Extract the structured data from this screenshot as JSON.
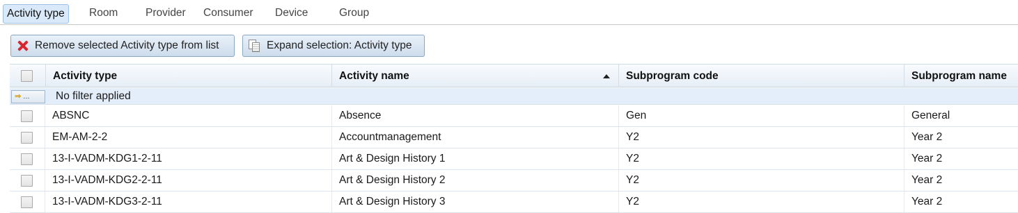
{
  "tabs": [
    {
      "label": "Activity type",
      "active": true
    },
    {
      "label": "Room"
    },
    {
      "label": "Provider"
    },
    {
      "label": "Consumer"
    },
    {
      "label": "Device"
    },
    {
      "label": "Group"
    }
  ],
  "toolbar": {
    "remove_label": "Remove selected Activity type from list",
    "remove_icon": "close-x-icon",
    "expand_label": "Expand selection: Activity type",
    "expand_icon": "documents-icon"
  },
  "grid": {
    "columns": [
      "Activity type",
      "Activity name",
      "Subprogram code",
      "Subprogram name"
    ],
    "sorted_column": "Activity name",
    "sort_direction": "ascending",
    "filter_button_label": "...",
    "filter_text": "No filter applied",
    "rows": [
      {
        "activity_type": "ABSNC",
        "activity_name": "Absence",
        "subprogram_code": "Gen",
        "subprogram_name": "General"
      },
      {
        "activity_type": "EM-AM-2-2",
        "activity_name": "Accountmanagement",
        "subprogram_code": "Y2",
        "subprogram_name": "Year 2"
      },
      {
        "activity_type": "13-I-VADM-KDG1-2-11",
        "activity_name": "Art & Design History 1",
        "subprogram_code": "Y2",
        "subprogram_name": "Year 2"
      },
      {
        "activity_type": "13-I-VADM-KDG2-2-11",
        "activity_name": "Art & Design History 2",
        "subprogram_code": "Y2",
        "subprogram_name": "Year 2"
      },
      {
        "activity_type": "13-I-VADM-KDG3-2-11",
        "activity_name": "Art & Design History 3",
        "subprogram_code": "Y2",
        "subprogram_name": "Year 2"
      }
    ]
  }
}
